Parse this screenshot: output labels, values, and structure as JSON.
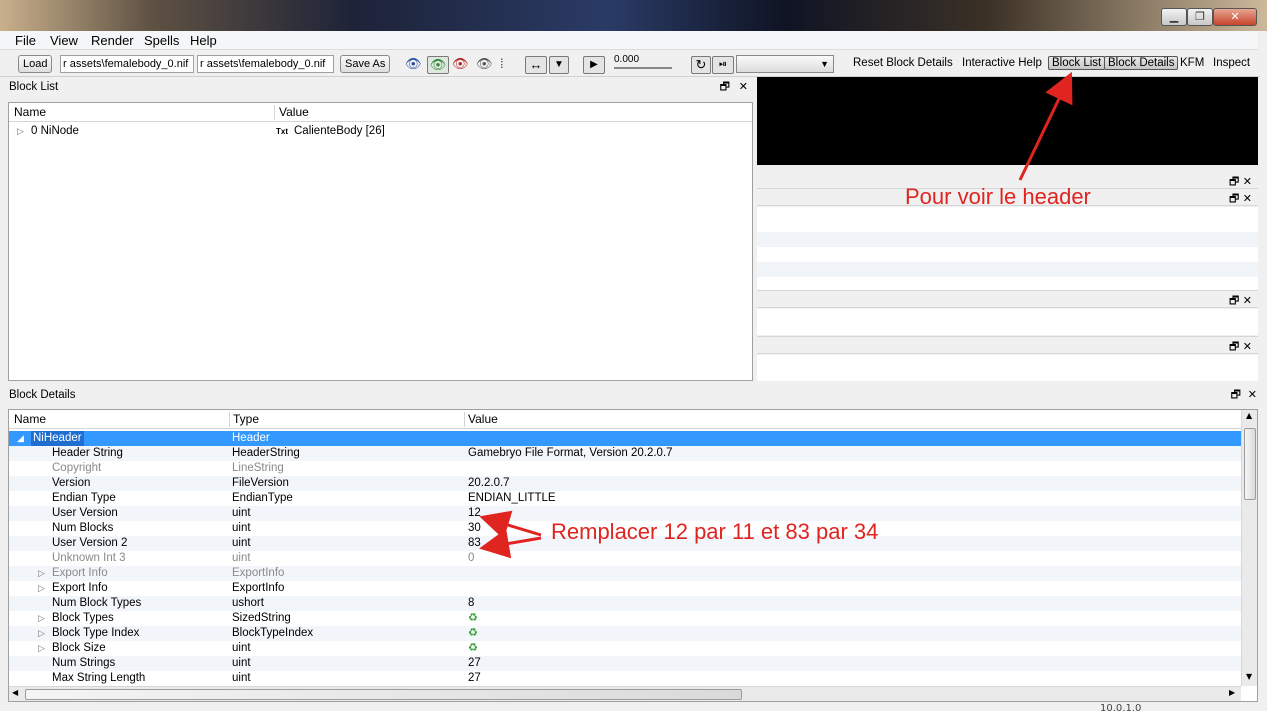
{
  "menu": [
    "File",
    "View",
    "Render",
    "Spells",
    "Help"
  ],
  "window_controls": {
    "minimize": "▁",
    "maximize": "❐",
    "close": "✕"
  },
  "toolbar": {
    "load_label": "Load",
    "path_field_1": "r assets\\femalebody_0.nif",
    "path_field_2": "r assets\\femalebody_0.nif",
    "save_as_label": "Save As",
    "time_value": "0.000",
    "reset_block_details": "Reset Block Details",
    "interactive_help": "Interactive Help",
    "block_list": "Block List",
    "block_details": "Block Details",
    "kfm": "KFM",
    "inspect": "Inspect"
  },
  "block_list": {
    "title": "Block List",
    "columns": [
      "Name",
      "Value"
    ],
    "rows": [
      {
        "name": "0 NiNode",
        "value_icon": "Txt",
        "value": "CalienteBody [26]"
      }
    ]
  },
  "block_details": {
    "title": "Block Details",
    "columns": [
      "Name",
      "Type",
      "Value"
    ],
    "rows": [
      {
        "name": "NiHeader",
        "type": "Header",
        "value": "",
        "state": "selected",
        "expander": "◢"
      },
      {
        "name": "Header String",
        "type": "HeaderString",
        "value": "Gamebryo File Format, Version 20.2.0.7"
      },
      {
        "name": "Copyright",
        "type": "LineString",
        "value": "",
        "state": "disabled"
      },
      {
        "name": "Version",
        "type": "FileVersion",
        "value": "20.2.0.7"
      },
      {
        "name": "Endian Type",
        "type": "EndianType",
        "value": "ENDIAN_LITTLE"
      },
      {
        "name": "User Version",
        "type": "uint",
        "value": "12"
      },
      {
        "name": "Num Blocks",
        "type": "uint",
        "value": "30"
      },
      {
        "name": "User Version 2",
        "type": "uint",
        "value": "83"
      },
      {
        "name": "Unknown Int 3",
        "type": "uint",
        "value": "0",
        "state": "disabled"
      },
      {
        "name": "Export Info",
        "type": "ExportInfo",
        "value": "",
        "state": "disabled",
        "expander": "▷"
      },
      {
        "name": "Export Info",
        "type": "ExportInfo",
        "value": "",
        "expander": "▷"
      },
      {
        "name": "Num Block Types",
        "type": "ushort",
        "value": "8"
      },
      {
        "name": "Block Types",
        "type": "SizedString",
        "value": "",
        "expander": "▷",
        "icon": "recycle-icon"
      },
      {
        "name": "Block Type Index",
        "type": "BlockTypeIndex",
        "value": "",
        "expander": "▷",
        "icon": "recycle-icon"
      },
      {
        "name": "Block Size",
        "type": "uint",
        "value": "",
        "expander": "▷",
        "icon": "recycle-icon"
      },
      {
        "name": "Num Strings",
        "type": "uint",
        "value": "27"
      },
      {
        "name": "Max String Length",
        "type": "uint",
        "value": "27"
      }
    ]
  },
  "annotations": {
    "header_note": "Pour voir le header",
    "replace_note": "Remplacer 12 par 11 et 83 par 34"
  },
  "bottom_partial_text": "10.0.1.0",
  "colors": {
    "selection": "#3399ff",
    "annotation": "#e0241f",
    "viewport": "#000000"
  }
}
